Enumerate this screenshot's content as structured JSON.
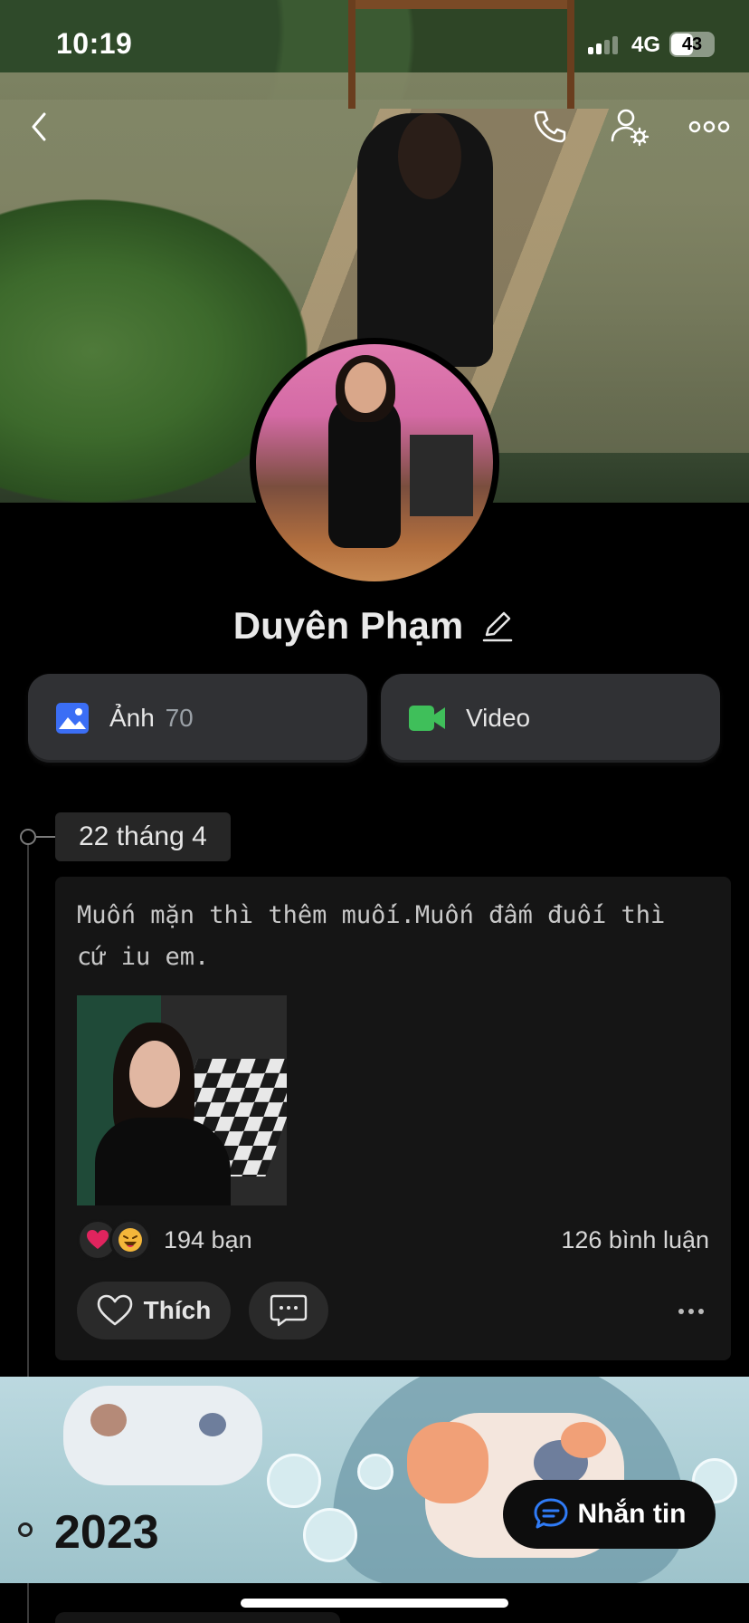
{
  "status_bar": {
    "time": "10:19",
    "network": "4G",
    "battery": "43"
  },
  "profile": {
    "name": "Duyên Phạm"
  },
  "media": {
    "photos_label": "Ảnh",
    "photos_count": "70",
    "videos_label": "Video"
  },
  "timeline": {
    "date": "22 tháng 4",
    "post": {
      "text": "Muốn mặn thì thêm muối.Muốn đấm đuối thì cứ iu em.",
      "reactions_count": "194 bạn",
      "comments_count": "126 bình luận",
      "like_label": "Thích"
    },
    "year": "2023"
  },
  "message_button": {
    "label": "Nhắn tin"
  },
  "colors": {
    "background": "#000000",
    "card": "#151515",
    "button": "#303134",
    "photo_icon": "#3b6ef5",
    "video_icon": "#3fbf5a",
    "message_icon": "#2f7bf6",
    "heart": "#e0245e"
  },
  "icons": [
    "back-icon",
    "phone-icon",
    "user-settings-icon",
    "more-icon",
    "edit-icon",
    "photo-icon",
    "video-icon",
    "heart-icon",
    "comment-icon",
    "message-icon"
  ]
}
